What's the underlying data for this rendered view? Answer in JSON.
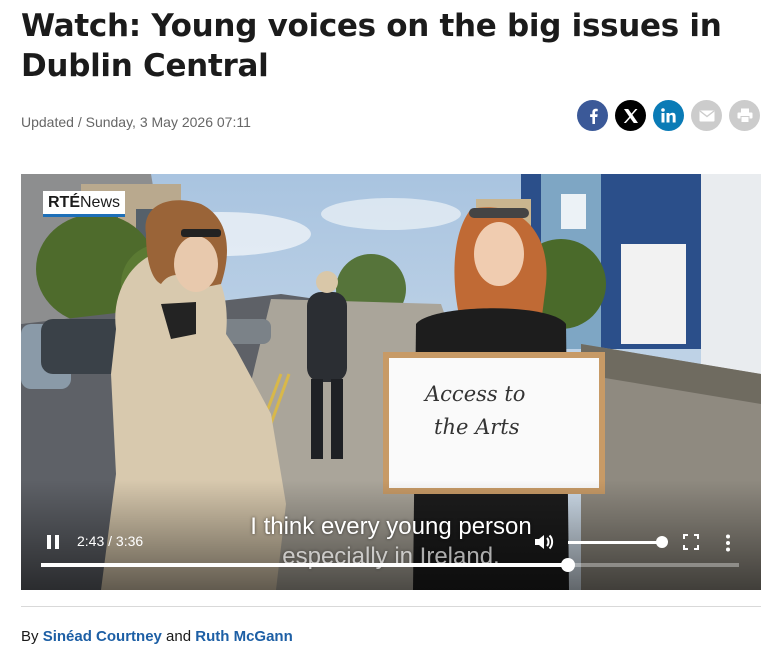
{
  "article": {
    "title": "Watch: Young voices on the big issues in Dublin Central",
    "updated": "Updated / Sunday, 3 May 2026 07:11"
  },
  "share": {
    "facebook_color": "#3b5998",
    "x_color": "#000000",
    "linkedin_color": "#0a7bb6",
    "email_color": "#cccccc",
    "print_color": "#cccccc",
    "icons": [
      "facebook-icon",
      "x-icon",
      "linkedin-icon",
      "email-icon",
      "print-icon"
    ]
  },
  "video": {
    "logo_brand": "RTÉ",
    "logo_word": "News",
    "whiteboard_line1": "Access to",
    "whiteboard_line2": "the Arts",
    "subtitle_line1": "I think every young person",
    "subtitle_line2": "especially in Ireland,",
    "time_display": "2:43 / 3:36",
    "played_fraction": 0.7546,
    "volume_fraction": 1.0,
    "state": "playing"
  },
  "byline": {
    "prefix": "By",
    "author1": "Sinéad Courtney",
    "joiner": "and",
    "author2": "Ruth McGann",
    "link_color": "#1d5fa5"
  }
}
